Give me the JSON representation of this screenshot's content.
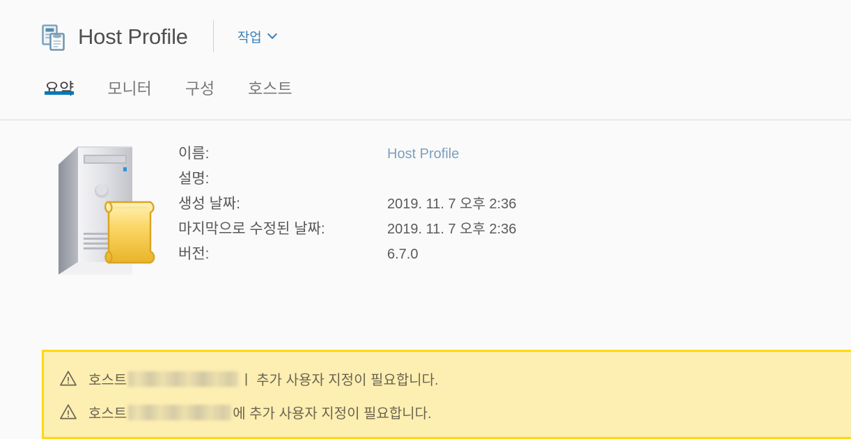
{
  "header": {
    "icon": "host-profile-icon",
    "title": "Host Profile",
    "actions_label": "작업",
    "chevron_icon": "chevron-down-icon",
    "accent_color": "#3b7fb5"
  },
  "tabs": {
    "active_index": 0,
    "active_underline_color": "#0079b8",
    "items": [
      {
        "label": "요약"
      },
      {
        "label": "모니터"
      },
      {
        "label": "구성"
      },
      {
        "label": "호스트"
      }
    ]
  },
  "summary": {
    "object_icon": "server-with-scroll-icon",
    "rows": [
      {
        "label": "이름:",
        "value": "Host Profile",
        "is_link": true
      },
      {
        "label": "설명:",
        "value": "",
        "is_link": false
      },
      {
        "label": "생성 날짜:",
        "value": "2019. 11. 7 오후 2:36",
        "is_link": false
      },
      {
        "label": "마지막으로 수정된 날짜:",
        "value": "2019. 11. 7 오후 2:36",
        "is_link": false
      },
      {
        "label": "버전:",
        "value": "6.7.0",
        "is_link": false
      }
    ]
  },
  "alerts": {
    "background_color": "#fdeeb2",
    "border_color": "#fcd913",
    "items": [
      {
        "icon": "warning-triangle-icon",
        "prefix": "호스트",
        "redacted": true,
        "suffix": "ㅣ 추가 사용자 지정이 필요합니다."
      },
      {
        "icon": "warning-triangle-icon",
        "prefix": "호스트",
        "redacted": true,
        "suffix": "에 추가 사용자 지정이 필요합니다."
      }
    ]
  }
}
